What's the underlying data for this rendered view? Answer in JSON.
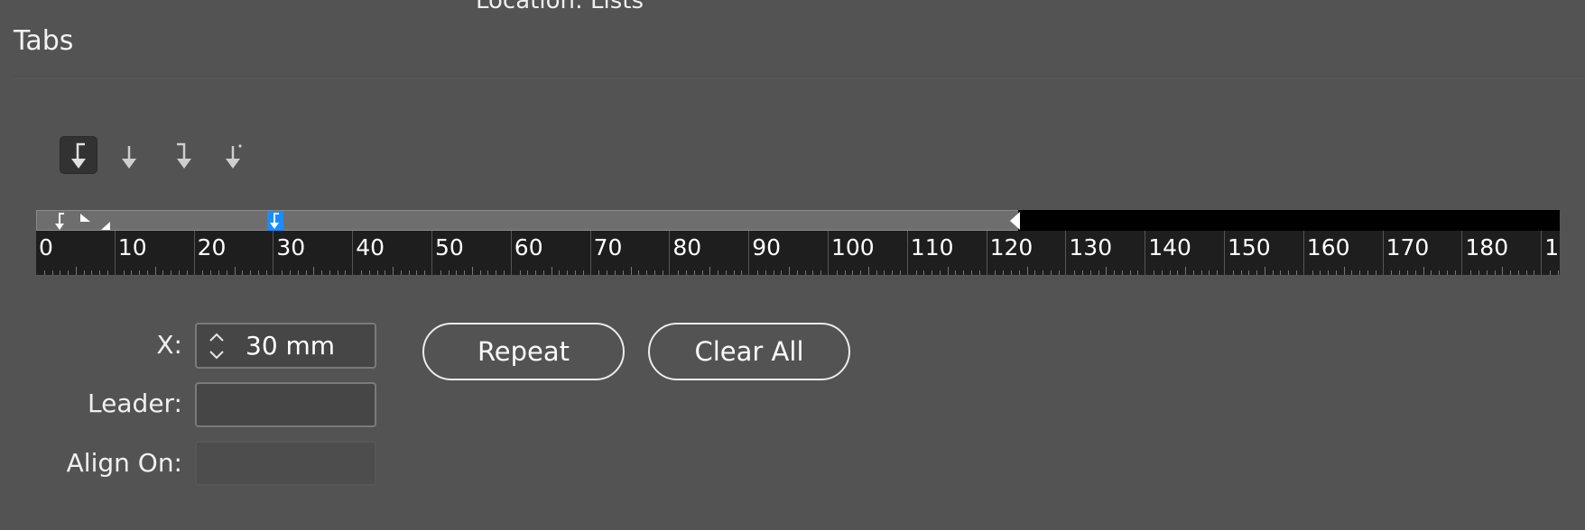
{
  "location": {
    "text": "Location:  Lists"
  },
  "panel": {
    "title": "Tabs"
  },
  "tab_types": [
    {
      "name": "left-justified-tab",
      "selected": true
    },
    {
      "name": "center-justified-tab",
      "selected": false
    },
    {
      "name": "right-justified-tab",
      "selected": false
    },
    {
      "name": "align-to-decimal-tab",
      "selected": false
    }
  ],
  "ruler": {
    "unit": "mm",
    "labels": [
      "0",
      "10",
      "20",
      "30",
      "40",
      "50",
      "60",
      "70",
      "80",
      "90",
      "100",
      "110",
      "120",
      "130",
      "140",
      "150",
      "160",
      "170",
      "180",
      "1"
    ],
    "tab_stop_mm": 30,
    "right_indent_mm": 120
  },
  "fields": {
    "x_label": "X:",
    "x_value": "30 mm",
    "leader_label": "Leader:",
    "leader_value": "",
    "align_label": "Align On:",
    "align_value": ""
  },
  "buttons": {
    "repeat": "Repeat",
    "clear_all": "Clear All"
  },
  "colors": {
    "panel_bg": "#535353",
    "selected_tab_marker": "#1a8cff"
  }
}
